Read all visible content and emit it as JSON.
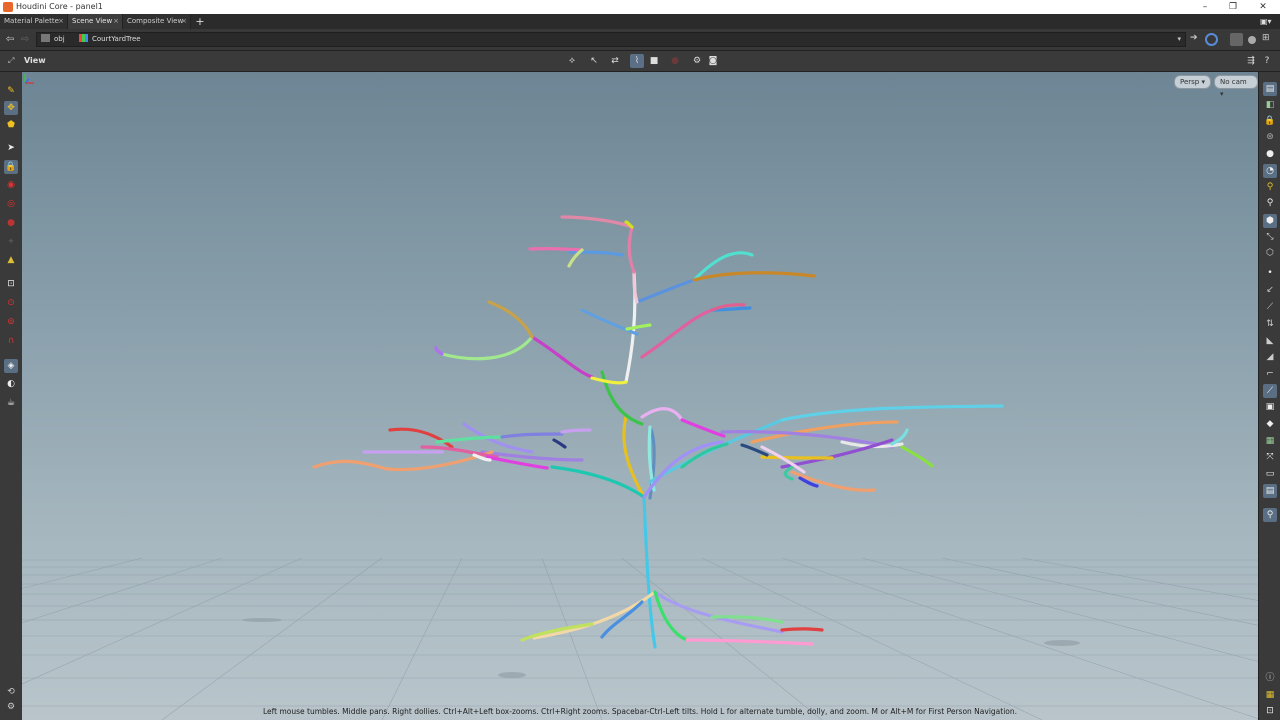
{
  "window": {
    "title": "Houdini Core - panel1",
    "controls": [
      "minimize",
      "restore",
      "close"
    ]
  },
  "tabs": [
    {
      "label": "Material Palette",
      "close": "×",
      "active": false
    },
    {
      "label": "Scene View",
      "close": "×",
      "active": true
    },
    {
      "label": "Composite View",
      "close": "×",
      "active": false
    }
  ],
  "add_tab": "+",
  "pathbar": {
    "crumbs": [
      "obj",
      "CourtYardTree"
    ],
    "dropdown": "▾"
  },
  "viewer": {
    "label": "View",
    "camera_persp": "Persp ▾",
    "camera_cam": "No cam ▾",
    "hint": "Left mouse tumbles. Middle pans. Right dollies. Ctrl+Alt+Left box-zooms. Ctrl+Right zooms. Spacebar-Ctrl-Left tilts. Hold L for alternate tumble, dolly, and zoom.     M or Alt+M for First Person Navigation."
  },
  "colors": {
    "accent": "#5b6f86",
    "bg_top": "#6d8594",
    "bg_bottom": "#b9c5cb"
  },
  "icons": {
    "left_toolbar": [
      "select-icon",
      "move-icon",
      "handle-icon",
      "pointer-icon",
      "lock-icon",
      "rotate-icon",
      "scale-icon",
      "pose-icon",
      "brush-icon",
      "box-icon",
      "lasso-icon",
      "magnet-icon",
      "snap-icon",
      "view-icon",
      "render-icon",
      "flipbook-icon"
    ],
    "right_toolbar": [
      "display-icon",
      "shading-icon",
      "lock-camera-icon",
      "ghost-icon",
      "sphere-icon",
      "light-icon",
      "lamp-icon",
      "bulb-icon",
      "geometry-icon",
      "point-icon",
      "normal-icon",
      "vector-icon",
      "edge-icon",
      "prim-icon",
      "wire-icon",
      "grid-icon",
      "ortho-icon",
      "background-icon",
      "info-icon",
      "layout-icon",
      "render-region-icon"
    ]
  }
}
